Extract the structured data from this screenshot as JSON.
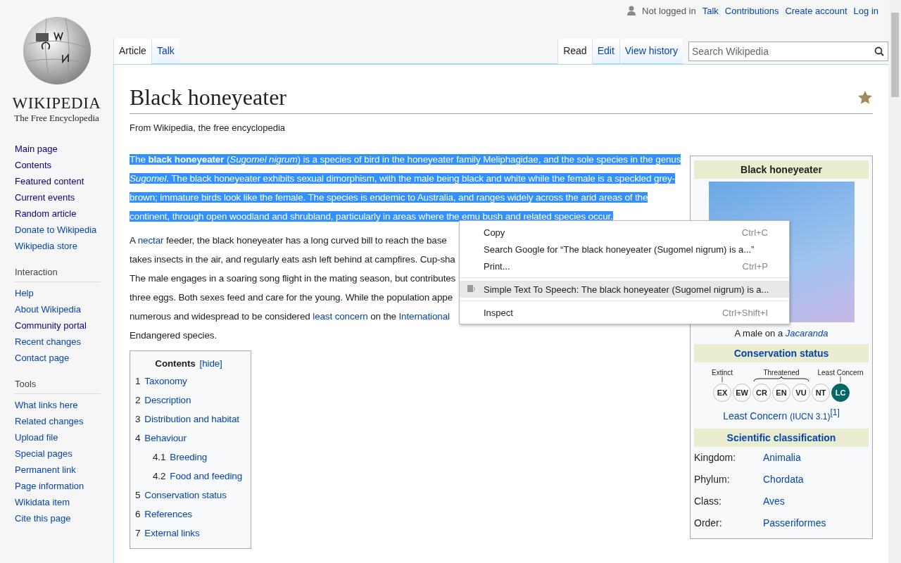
{
  "user_links": {
    "status": "Not logged in",
    "links": [
      "Talk",
      "Contributions",
      "Create account",
      "Log in"
    ]
  },
  "logo": {
    "wordmark": "WIKIPEDIA",
    "tagline": "The Free Encyclopedia"
  },
  "sidebar": {
    "navigation": [
      {
        "label": "Main page",
        "visited": true
      },
      {
        "label": "Contents",
        "visited": true
      },
      {
        "label": "Featured content",
        "visited": true
      },
      {
        "label": "Current events",
        "visited": true
      },
      {
        "label": "Random article",
        "visited": true
      },
      {
        "label": "Donate to Wikipedia",
        "visited": false
      },
      {
        "label": "Wikipedia store",
        "visited": false
      }
    ],
    "sections": [
      {
        "heading": "Interaction",
        "items": [
          {
            "label": "Help",
            "visited": false
          },
          {
            "label": "About Wikipedia",
            "visited": false
          },
          {
            "label": "Community portal",
            "visited": true
          },
          {
            "label": "Recent changes",
            "visited": false
          },
          {
            "label": "Contact page",
            "visited": false
          }
        ]
      },
      {
        "heading": "Tools",
        "items": [
          {
            "label": "What links here",
            "visited": false
          },
          {
            "label": "Related changes",
            "visited": false
          },
          {
            "label": "Upload file",
            "visited": false
          },
          {
            "label": "Special pages",
            "visited": false
          },
          {
            "label": "Permanent link",
            "visited": false
          },
          {
            "label": "Page information",
            "visited": false
          },
          {
            "label": "Wikidata item",
            "visited": false
          },
          {
            "label": "Cite this page",
            "visited": false
          }
        ]
      }
    ]
  },
  "namespace_tabs": [
    {
      "label": "Article",
      "selected": true
    },
    {
      "label": "Talk",
      "selected": false
    }
  ],
  "view_tabs": [
    {
      "label": "Read",
      "selected": true
    },
    {
      "label": "Edit",
      "selected": false
    },
    {
      "label": "View history",
      "selected": false
    }
  ],
  "search": {
    "placeholder": "Search Wikipedia"
  },
  "article": {
    "title": "Black honeyeater",
    "subtitle": "From Wikipedia, the free encyclopedia",
    "lead": "The **black honeyeater** (*Sugomel nigrum*) is a species of bird in the honeyeater family Meliphagidae, and the sole species in the genus *Sugomel*. The black honeyeater exhibits sexual dimorphism, with the male being black and white while the female is a speckled grey-brown; immature birds look like the female. The species is endemic to Australia, and ranges widely across the arid areas of the continent, through open woodland and shrubland, particularly in areas where the emu bush and related species occur.",
    "paragraph_lines": [
      [
        {
          "text": "A ",
          "link": false
        },
        {
          "text": "nectar",
          "link": true
        },
        {
          "text": " feeder, the black honeyeater has a long curved bill to reach the base",
          "link": false
        }
      ],
      [
        {
          "text": "takes insects in the air, and regularly eats ash left behind at campfires. Cup-sha",
          "link": false
        }
      ],
      [
        {
          "text": "The male engages in a soaring song flight in the mating season, but contributes",
          "link": false
        }
      ],
      [
        {
          "text": "three eggs. Both sexes feed and care for the young. While the population appe",
          "link": false
        }
      ],
      [
        {
          "text": "numerous and widespread to be considered ",
          "link": false
        },
        {
          "text": "least concern",
          "link": true
        },
        {
          "text": " on the ",
          "link": false
        },
        {
          "text": "International",
          "link": true
        }
      ],
      [
        {
          "text": "Endangered species.",
          "link": false
        }
      ]
    ]
  },
  "toc": {
    "title": "Contents",
    "toggle": "[hide]",
    "items": [
      {
        "number": "1",
        "label": "Taxonomy"
      },
      {
        "number": "2",
        "label": "Description"
      },
      {
        "number": "3",
        "label": "Distribution and habitat"
      },
      {
        "number": "4",
        "label": "Behaviour",
        "children": [
          {
            "number": "4.1",
            "label": "Breeding"
          },
          {
            "number": "4.2",
            "label": "Food and feeding"
          }
        ]
      },
      {
        "number": "5",
        "label": "Conservation status"
      },
      {
        "number": "6",
        "label": "References"
      },
      {
        "number": "7",
        "label": "External links"
      }
    ]
  },
  "infobox": {
    "title": "Black honeyeater",
    "caption_text": "A male on a",
    "caption_link": "Jacaranda",
    "conservation": {
      "heading": "Conservation status",
      "scale_labels": [
        {
          "label": "Extinct",
          "kind": "tick"
        },
        {
          "label": "Threatened",
          "kind": "brace"
        },
        {
          "label": "Least Concern",
          "kind": "tick"
        }
      ],
      "statuses": [
        {
          "code": "EX",
          "selected": false
        },
        {
          "code": "EW",
          "selected": false
        },
        {
          "code": "CR",
          "selected": false
        },
        {
          "code": "EN",
          "selected": false
        },
        {
          "code": "VU",
          "selected": false
        },
        {
          "code": "NT",
          "selected": false
        },
        {
          "code": "LC",
          "selected": true
        }
      ],
      "status_text": "Least Concern",
      "status_source": "(IUCN 3.1)",
      "reference": "[1]"
    },
    "classification": {
      "heading": "Scientific classification",
      "rows": [
        {
          "rank": "Kingdom:",
          "taxon": "Animalia"
        },
        {
          "rank": "Phylum:",
          "taxon": "Chordata"
        },
        {
          "rank": "Class:",
          "taxon": "Aves"
        },
        {
          "rank": "Order:",
          "taxon": "Passeriformes"
        }
      ]
    }
  },
  "context_menu": {
    "items": [
      {
        "kind": "item",
        "label": "Copy",
        "shortcut": "Ctrl+C",
        "selected": false
      },
      {
        "kind": "item",
        "label": "Search Google for “The black honeyeater (Sugomel nigrum) is a...”",
        "selected": false
      },
      {
        "kind": "item",
        "label": "Print...",
        "shortcut": "Ctrl+P",
        "selected": false
      },
      {
        "kind": "separator"
      },
      {
        "kind": "extension",
        "label": "Simple Text To Speech: The black honeyeater (Sugomel nigrum) is a...",
        "selected": true
      },
      {
        "kind": "separator"
      },
      {
        "kind": "item",
        "label": "Inspect",
        "shortcut": "Ctrl+Shift+I",
        "selected": false
      }
    ]
  }
}
